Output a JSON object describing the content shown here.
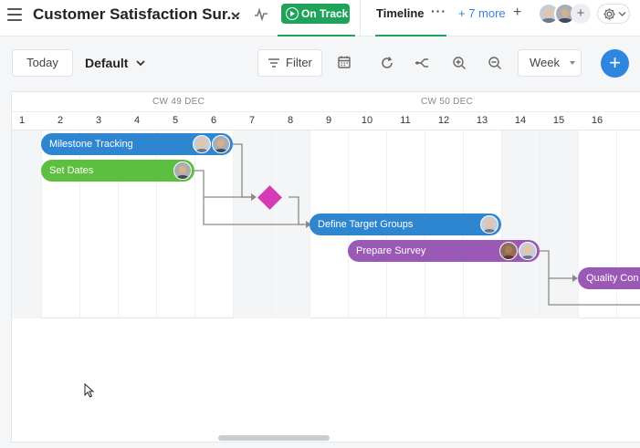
{
  "header": {
    "title": "Customer Satisfaction Sur...",
    "status_label": "On Track",
    "tabs": {
      "active": "Timeline",
      "more": "+ 7 more",
      "add": "+"
    },
    "avatar_add": "+"
  },
  "toolbar": {
    "today_label": "Today",
    "view_select": "Default",
    "filter_label": "Filter",
    "scale_select": "Week",
    "create_label": "+"
  },
  "timeline": {
    "week_labels": [
      "CW 49 DEC",
      "CW 50 DEC"
    ],
    "days": [
      "1",
      "2",
      "3",
      "4",
      "5",
      "6",
      "7",
      "8",
      "9",
      "10",
      "11",
      "12",
      "13",
      "14",
      "15",
      "16"
    ],
    "tasks": [
      {
        "name": "Milestone Tracking",
        "color": "#2f86d0"
      },
      {
        "name": "Set Dates",
        "color": "#5cbf3f"
      },
      {
        "name": "Define Target Groups",
        "color": "#2f86d0"
      },
      {
        "name": "Prepare Survey",
        "color": "#9b59b6"
      },
      {
        "name": "Quality Con",
        "color": "#9b59b6"
      }
    ],
    "milestone_color": "#d63bb5"
  },
  "icons": {
    "menu": "hamburger-icon",
    "activity": "activity-icon",
    "status": "play-circle-icon",
    "filter": "filter-icon",
    "calendar": "calendar-icon",
    "refresh": "refresh-icon",
    "dependencies": "share-icon",
    "zoom_in": "zoom-in-icon",
    "zoom_out": "zoom-out-icon",
    "settings": "gear-icon"
  }
}
